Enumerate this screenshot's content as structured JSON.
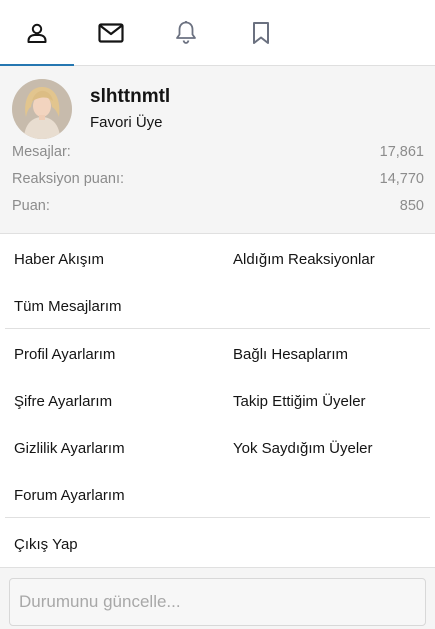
{
  "tabs": [
    {
      "icon": "user-icon",
      "active": true
    },
    {
      "icon": "envelope-icon",
      "active": false
    },
    {
      "icon": "bell-icon",
      "active": false
    },
    {
      "icon": "bookmark-icon",
      "active": false
    }
  ],
  "colors": {
    "accent": "#2577b1",
    "panel_bg": "#f5f5f5",
    "muted_text": "#8c8c8c"
  },
  "profile": {
    "username": "slhttnmtl",
    "title": "Favori Üye",
    "stats": [
      {
        "label": "Mesajlar:",
        "value": "17,861"
      },
      {
        "label": "Reaksiyon puanı:",
        "value": "14,770"
      },
      {
        "label": "Puan:",
        "value": "850"
      }
    ]
  },
  "menu": {
    "group1": {
      "news_feed": "Haber Akışım",
      "reactions_received": "Aldığım Reaksiyonlar",
      "all_messages": "Tüm Mesajlarım"
    },
    "group2": {
      "profile_settings": "Profil Ayarlarım",
      "connected_accounts": "Bağlı Hesaplarım",
      "password_settings": "Şifre Ayarlarım",
      "following": "Takip Ettiğim Üyeler",
      "privacy_settings": "Gizlilik Ayarlarım",
      "ignored_members": "Yok Saydığım Üyeler",
      "forum_settings": "Forum Ayarlarım"
    },
    "logout": "Çıkış Yap"
  },
  "status": {
    "placeholder": "Durumunu güncelle...",
    "value": ""
  }
}
